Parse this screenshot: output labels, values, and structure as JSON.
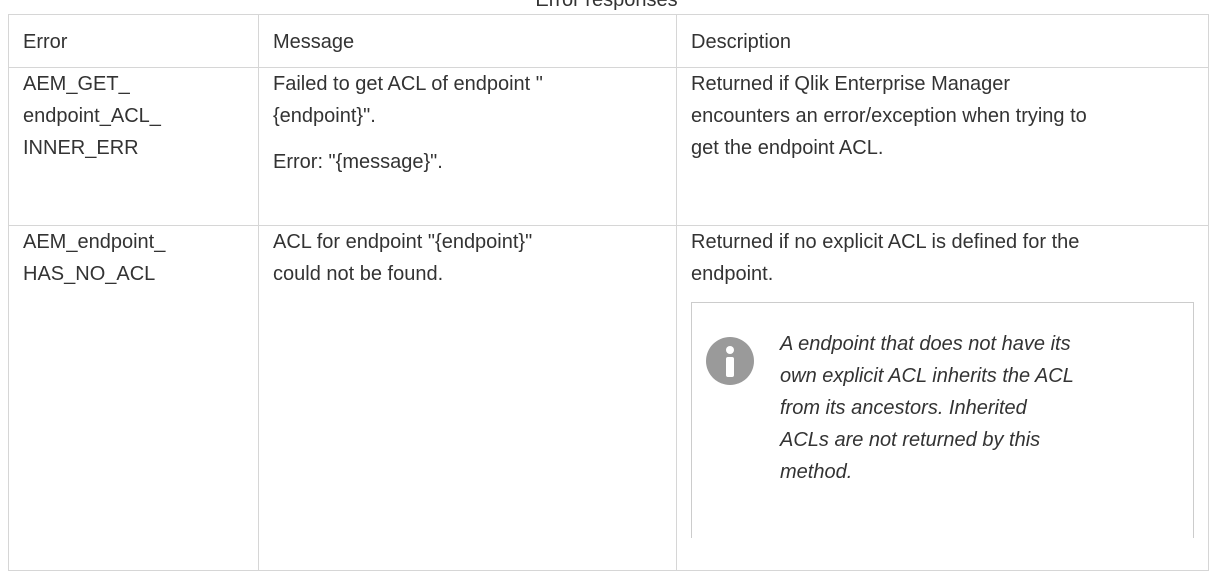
{
  "caption": "Error responses",
  "table": {
    "headers": [
      "Error",
      "Message",
      "Description"
    ],
    "rows": [
      {
        "error_lines": [
          "AEM_GET_",
          "endpoint_ACL_",
          "INNER_ERR"
        ],
        "message_lines": [
          "Failed to get ACL of endpoint \"",
          "{endpoint}\"."
        ],
        "message_extra": "Error: \"{message}\".",
        "description_lines": [
          "Returned if Qlik Enterprise Manager",
          "encounters an error/exception when trying to",
          "get the endpoint ACL."
        ]
      },
      {
        "error_lines": [
          "AEM_endpoint_",
          "HAS_NO_ACL"
        ],
        "message_lines": [
          "ACL for endpoint \"{endpoint}\"",
          "could not be found."
        ],
        "description_lines": [
          "Returned if no explicit ACL is defined for the",
          "endpoint."
        ],
        "note": {
          "icon": "info-icon",
          "lines": [
            "A endpoint that does not have its",
            "own explicit ACL inherits the ACL",
            "from its ancestors. Inherited",
            "ACLs are not returned by this",
            "method."
          ]
        }
      }
    ]
  },
  "colors": {
    "text": "#333333",
    "border": "#d6d6d6",
    "icon": "#9a9a9a"
  }
}
